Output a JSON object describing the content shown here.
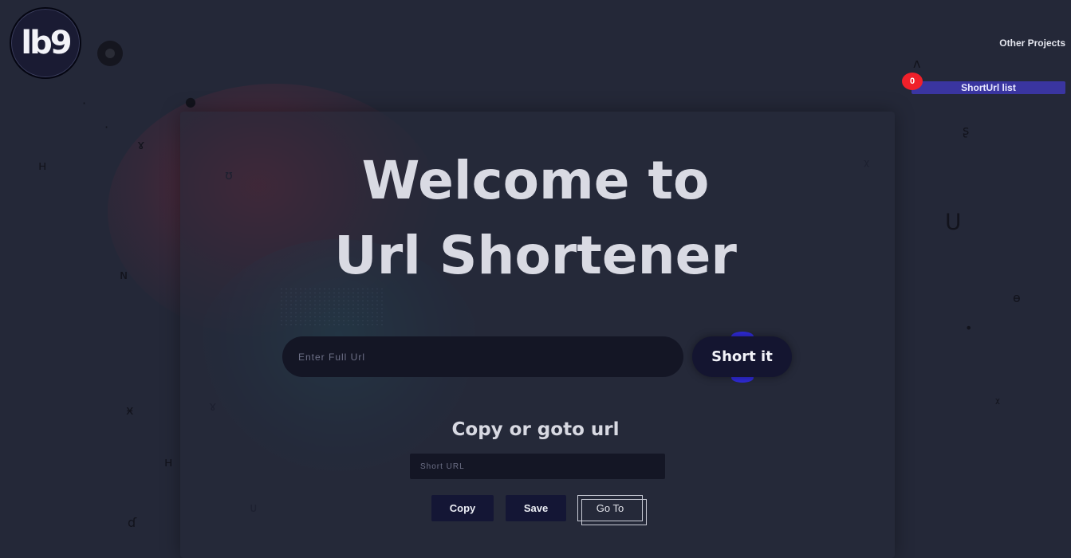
{
  "logo": {
    "text": "lb9"
  },
  "header": {
    "other_projects": "Other Projects",
    "shorturl_list": "ShortUrl list",
    "badge_count": "0"
  },
  "hero": {
    "title_line1": "Welcome to",
    "title_line2": "Url Shortener"
  },
  "form": {
    "full_url_placeholder": "Enter Full Url",
    "short_button": "Short it"
  },
  "result": {
    "heading": "Copy or goto url",
    "short_url_placeholder": "Short URL",
    "copy_label": "Copy",
    "save_label": "Save",
    "goto_label": "Go To"
  },
  "colors": {
    "background": "#242838",
    "accent": "#3a35a0",
    "badge": "#f0202a",
    "button": "#141635"
  }
}
